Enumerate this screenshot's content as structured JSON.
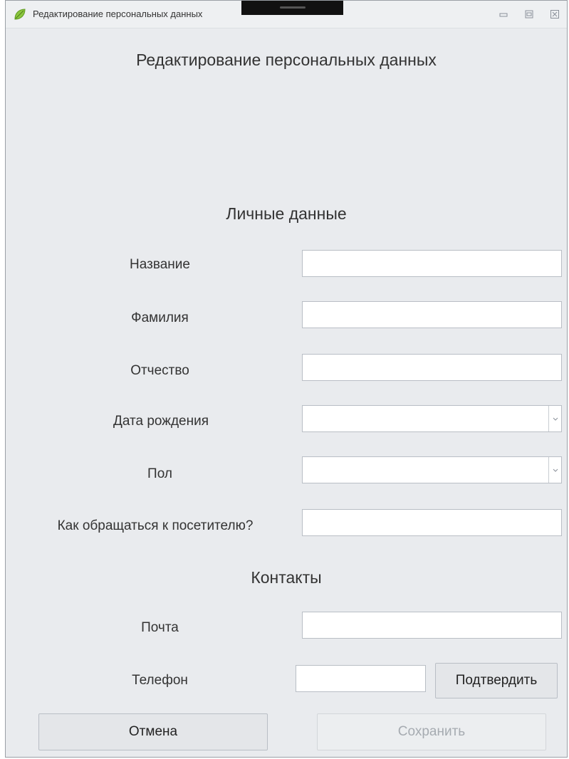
{
  "window": {
    "title": "Редактирование персональных данных"
  },
  "form": {
    "title": "Редактирование персональных данных",
    "personal_section": "Личные данные",
    "fields": {
      "name": {
        "label": "Название",
        "value": ""
      },
      "surname": {
        "label": "Фамилия",
        "value": ""
      },
      "patronymic": {
        "label": "Отчество",
        "value": ""
      },
      "birthdate": {
        "label": "Дата рождения",
        "value": ""
      },
      "gender": {
        "label": "Пол",
        "value": ""
      },
      "address_as": {
        "label": "Как обращаться к посетителю?",
        "value": ""
      }
    },
    "contacts_section": "Контакты",
    "contacts": {
      "email": {
        "label": "Почта",
        "value": ""
      },
      "phone": {
        "label": "Телефон",
        "value": ""
      }
    },
    "buttons": {
      "confirm": "Подтвердить",
      "cancel": "Отмена",
      "save": "Сохранить"
    }
  },
  "colors": {
    "window_bg": "#e9ebee",
    "field_border": "#b9bec5",
    "disabled_text": "#a6abb1"
  }
}
